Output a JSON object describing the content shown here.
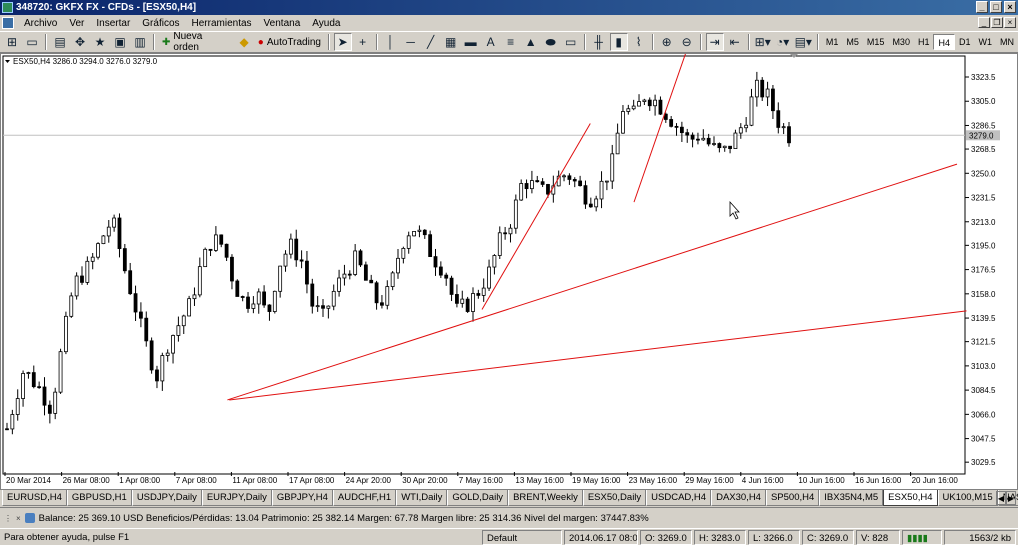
{
  "window": {
    "title": "348720: GKFX FX - CFDs - [ESX50,H4]"
  },
  "menu": [
    "Archivo",
    "Ver",
    "Insertar",
    "Gráficos",
    "Herramientas",
    "Ventana",
    "Ayuda"
  ],
  "toolbar": {
    "new_order_label": "Nueva orden",
    "autotrading_label": "AutoTrading",
    "timeframes": [
      "M1",
      "M5",
      "M15",
      "M30",
      "H1",
      "H4",
      "D1",
      "W1",
      "MN"
    ],
    "active_timeframe": "H4"
  },
  "chart": {
    "info": "ESX50,H4  3286.0 3294.0 3276.0 3279.0",
    "current_price_label": "3279.0",
    "bid_line_price": 3279,
    "colors": {
      "up": "#000000",
      "down": "#000000",
      "trendline": "#e01010",
      "bid_line": "#c0c0c0",
      "price_tag_bg": "#c0c0c0"
    }
  },
  "chart_data": {
    "type": "candlestick",
    "symbol": "ESX50",
    "timeframe": "H4",
    "y_ticks": [
      3323.5,
      3305.0,
      3286.5,
      3268.5,
      3250.0,
      3231.5,
      3213.0,
      3195.0,
      3176.5,
      3158.0,
      3139.5,
      3121.5,
      3103.0,
      3084.5,
      3066.0,
      3047.5,
      3029.5
    ],
    "ylim": [
      3022,
      3338
    ],
    "x_ticks": [
      "20 Mar 2014",
      "26 Mar 08:00",
      "1 Apr 08:00",
      "7 Apr 08:00",
      "11 Apr 08:00",
      "17 Apr 08:00",
      "24 Apr 20:00",
      "30 Apr 20:00",
      "7 May 16:00",
      "13 May 16:00",
      "19 May 16:00",
      "23 May 16:00",
      "29 May 16:00",
      "4 Jun 16:00",
      "10 Jun 16:00",
      "16 Jun 16:00",
      "20 Jun 16:00"
    ],
    "close_path": [
      [
        0,
        3055
      ],
      [
        3,
        3100
      ],
      [
        6,
        3085
      ],
      [
        8,
        3070
      ],
      [
        10,
        3120
      ],
      [
        12,
        3165
      ],
      [
        15,
        3180
      ],
      [
        17,
        3200
      ],
      [
        19,
        3215
      ],
      [
        21,
        3180
      ],
      [
        23,
        3150
      ],
      [
        25,
        3120
      ],
      [
        27,
        3095
      ],
      [
        29,
        3120
      ],
      [
        31,
        3135
      ],
      [
        33,
        3150
      ],
      [
        35,
        3180
      ],
      [
        37,
        3200
      ],
      [
        39,
        3195
      ],
      [
        41,
        3165
      ],
      [
        43,
        3150
      ],
      [
        45,
        3160
      ],
      [
        47,
        3140
      ],
      [
        49,
        3180
      ],
      [
        51,
        3195
      ],
      [
        53,
        3185
      ],
      [
        55,
        3150
      ],
      [
        57,
        3140
      ],
      [
        59,
        3160
      ],
      [
        61,
        3175
      ],
      [
        63,
        3185
      ],
      [
        65,
        3165
      ],
      [
        67,
        3150
      ],
      [
        69,
        3160
      ],
      [
        71,
        3195
      ],
      [
        73,
        3210
      ],
      [
        75,
        3200
      ],
      [
        77,
        3185
      ],
      [
        79,
        3175
      ],
      [
        81,
        3145
      ],
      [
        83,
        3150
      ],
      [
        85,
        3160
      ],
      [
        87,
        3175
      ],
      [
        89,
        3200
      ],
      [
        91,
        3215
      ],
      [
        93,
        3245
      ],
      [
        95,
        3240
      ],
      [
        97,
        3235
      ],
      [
        99,
        3245
      ],
      [
        101,
        3250
      ],
      [
        103,
        3240
      ],
      [
        105,
        3230
      ],
      [
        107,
        3240
      ],
      [
        109,
        3255
      ],
      [
        111,
        3300
      ],
      [
        113,
        3295
      ],
      [
        115,
        3310
      ],
      [
        117,
        3305
      ],
      [
        119,
        3295
      ],
      [
        121,
        3285
      ],
      [
        123,
        3275
      ],
      [
        125,
        3280
      ],
      [
        127,
        3270
      ],
      [
        129,
        3265
      ],
      [
        131,
        3275
      ],
      [
        133,
        3290
      ],
      [
        135,
        3315
      ],
      [
        137,
        3310
      ],
      [
        139,
        3290
      ],
      [
        141,
        3279
      ]
    ],
    "trendlines": [
      {
        "from": [
          11.7,
          3077
        ],
        "to": [
          50.5,
          3145
        ]
      },
      {
        "from": [
          25.0,
          3146
        ],
        "to": [
          30.7,
          3288
        ]
      },
      {
        "from": [
          33.0,
          3228
        ],
        "to": [
          35.8,
          3345
        ]
      },
      {
        "from": [
          11.6,
          3077
        ],
        "to": [
          50.0,
          3257
        ]
      }
    ]
  },
  "tabs": [
    "EURUSD,H4",
    "GBPUSD,H1",
    "USDJPY,Daily",
    "EURJPY,Daily",
    "GBPJPY,H4",
    "AUDCHF,H1",
    "WTI,Daily",
    "GOLD,Daily",
    "BRENT,Weekly",
    "ESX50,Daily",
    "USDCAD,H4",
    "DAX30,H4",
    "SP500,H4",
    "IBX35N4,M5",
    "ESX50,H4",
    "UK100,M15",
    "NAS100,Daily"
  ],
  "active_tab": "ESX50,H4",
  "terminal": {
    "balance_line": "Balance: 25 369.10 USD  Beneficios/Pérdidas: 13.04  Patrimonio: 25 382.14  Margen: 67.78  Margen libre: 25 314.36  Nivel del margen: 37447.83%"
  },
  "status": {
    "help": "Para obtener ayuda, pulse F1",
    "profile": "Default",
    "datetime": "2014.06.17 08:00",
    "open": "O: 3269.0",
    "high": "H: 3283.0",
    "low": "L: 3266.0",
    "close": "C: 3269.0",
    "volume": "V: 828",
    "traffic": "1563/2 kb"
  }
}
